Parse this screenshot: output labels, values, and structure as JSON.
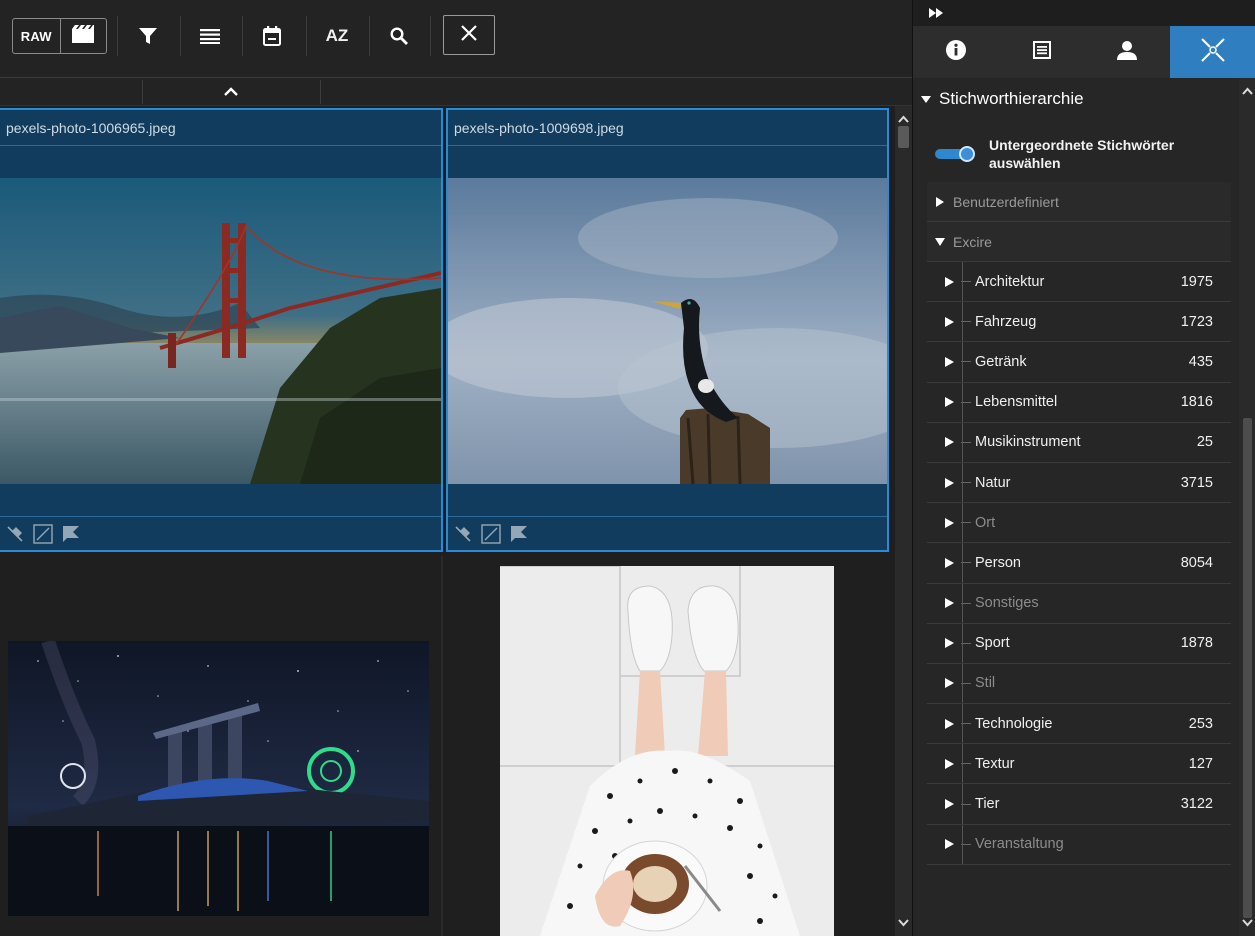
{
  "toolbar": {
    "raw_label": "RAW",
    "sort_label": "AZ",
    "icons": [
      "film-icon",
      "filter-icon",
      "list-icon",
      "calendar-icon",
      "sort-az-icon",
      "search-icon",
      "close-icon"
    ]
  },
  "grid": {
    "cells": [
      {
        "filename": "pexels-photo-1006965.jpeg",
        "selected": true,
        "image": "golden-gate-bridge-sunset"
      },
      {
        "filename": "pexels-photo-1009698.jpeg",
        "selected": true,
        "image": "cormorant-on-post"
      },
      {
        "filename": "",
        "selected": false,
        "image": "singapore-marina-bay-night"
      },
      {
        "filename": "",
        "selected": false,
        "image": "feet-sneakers-coffee"
      }
    ]
  },
  "right_panel": {
    "tabs": [
      "info-icon",
      "table-icon",
      "person-icon",
      "keyword-network-icon"
    ],
    "active_tab": 3,
    "section_title": "Stichworthierarchie",
    "toggle_label": "Untergeordnete Stichwörter auswählen",
    "toggle_on": true,
    "groups": [
      {
        "label": "Benutzerdefiniert",
        "expanded": false
      },
      {
        "label": "Excire",
        "expanded": true
      }
    ],
    "keywords": [
      {
        "label": "Architektur",
        "count": "1975"
      },
      {
        "label": "Fahrzeug",
        "count": "1723"
      },
      {
        "label": "Getränk",
        "count": "435"
      },
      {
        "label": "Lebensmittel",
        "count": "1816"
      },
      {
        "label": "Musikinstrument",
        "count": "25"
      },
      {
        "label": "Natur",
        "count": "3715"
      },
      {
        "label": "Ort",
        "count": ""
      },
      {
        "label": "Person",
        "count": "8054"
      },
      {
        "label": "Sonstiges",
        "count": ""
      },
      {
        "label": "Sport",
        "count": "1878"
      },
      {
        "label": "Stil",
        "count": ""
      },
      {
        "label": "Technologie",
        "count": "253"
      },
      {
        "label": "Textur",
        "count": "127"
      },
      {
        "label": "Tier",
        "count": "3122"
      },
      {
        "label": "Veranstaltung",
        "count": ""
      }
    ]
  },
  "colors": {
    "accent": "#2f7fc0",
    "selection_bg": "#123c5e",
    "selection_border": "#2a8ad6"
  }
}
